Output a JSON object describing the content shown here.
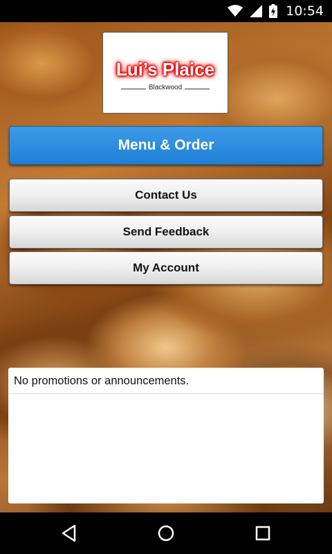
{
  "status_bar": {
    "time": "10:54",
    "icons": [
      "wifi-icon",
      "cell-signal-icon",
      "battery-charging-icon"
    ]
  },
  "logo": {
    "title": "Lui’s Plaice",
    "subtitle": "Blackwood",
    "title_glow_color": "#ff0000"
  },
  "buttons": {
    "menu_order": "Menu & Order",
    "contact_us": "Contact Us",
    "send_feedback": "Send Feedback",
    "my_account": "My Account"
  },
  "announcements": {
    "text": "No promotions or announcements."
  },
  "nav": {
    "icons": [
      "back-icon",
      "home-icon",
      "recents-icon"
    ]
  },
  "colors": {
    "primary_button": "#2a8ee0",
    "secondary_button": "#efefef"
  }
}
